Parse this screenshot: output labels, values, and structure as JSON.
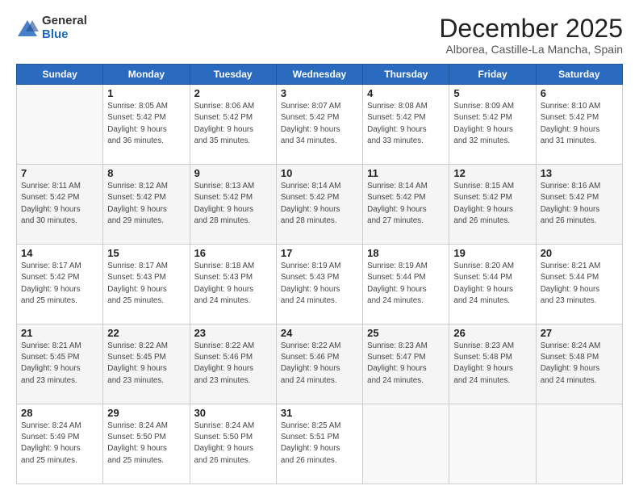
{
  "header": {
    "logo_line1": "General",
    "logo_line2": "Blue",
    "title": "December 2025",
    "subtitle": "Alborea, Castille-La Mancha, Spain"
  },
  "calendar": {
    "days_of_week": [
      "Sunday",
      "Monday",
      "Tuesday",
      "Wednesday",
      "Thursday",
      "Friday",
      "Saturday"
    ],
    "weeks": [
      {
        "shade": false,
        "days": [
          {
            "num": "",
            "detail": ""
          },
          {
            "num": "1",
            "detail": "Sunrise: 8:05 AM\nSunset: 5:42 PM\nDaylight: 9 hours\nand 36 minutes."
          },
          {
            "num": "2",
            "detail": "Sunrise: 8:06 AM\nSunset: 5:42 PM\nDaylight: 9 hours\nand 35 minutes."
          },
          {
            "num": "3",
            "detail": "Sunrise: 8:07 AM\nSunset: 5:42 PM\nDaylight: 9 hours\nand 34 minutes."
          },
          {
            "num": "4",
            "detail": "Sunrise: 8:08 AM\nSunset: 5:42 PM\nDaylight: 9 hours\nand 33 minutes."
          },
          {
            "num": "5",
            "detail": "Sunrise: 8:09 AM\nSunset: 5:42 PM\nDaylight: 9 hours\nand 32 minutes."
          },
          {
            "num": "6",
            "detail": "Sunrise: 8:10 AM\nSunset: 5:42 PM\nDaylight: 9 hours\nand 31 minutes."
          }
        ]
      },
      {
        "shade": true,
        "days": [
          {
            "num": "7",
            "detail": "Sunrise: 8:11 AM\nSunset: 5:42 PM\nDaylight: 9 hours\nand 30 minutes."
          },
          {
            "num": "8",
            "detail": "Sunrise: 8:12 AM\nSunset: 5:42 PM\nDaylight: 9 hours\nand 29 minutes."
          },
          {
            "num": "9",
            "detail": "Sunrise: 8:13 AM\nSunset: 5:42 PM\nDaylight: 9 hours\nand 28 minutes."
          },
          {
            "num": "10",
            "detail": "Sunrise: 8:14 AM\nSunset: 5:42 PM\nDaylight: 9 hours\nand 28 minutes."
          },
          {
            "num": "11",
            "detail": "Sunrise: 8:14 AM\nSunset: 5:42 PM\nDaylight: 9 hours\nand 27 minutes."
          },
          {
            "num": "12",
            "detail": "Sunrise: 8:15 AM\nSunset: 5:42 PM\nDaylight: 9 hours\nand 26 minutes."
          },
          {
            "num": "13",
            "detail": "Sunrise: 8:16 AM\nSunset: 5:42 PM\nDaylight: 9 hours\nand 26 minutes."
          }
        ]
      },
      {
        "shade": false,
        "days": [
          {
            "num": "14",
            "detail": "Sunrise: 8:17 AM\nSunset: 5:42 PM\nDaylight: 9 hours\nand 25 minutes."
          },
          {
            "num": "15",
            "detail": "Sunrise: 8:17 AM\nSunset: 5:43 PM\nDaylight: 9 hours\nand 25 minutes."
          },
          {
            "num": "16",
            "detail": "Sunrise: 8:18 AM\nSunset: 5:43 PM\nDaylight: 9 hours\nand 24 minutes."
          },
          {
            "num": "17",
            "detail": "Sunrise: 8:19 AM\nSunset: 5:43 PM\nDaylight: 9 hours\nand 24 minutes."
          },
          {
            "num": "18",
            "detail": "Sunrise: 8:19 AM\nSunset: 5:44 PM\nDaylight: 9 hours\nand 24 minutes."
          },
          {
            "num": "19",
            "detail": "Sunrise: 8:20 AM\nSunset: 5:44 PM\nDaylight: 9 hours\nand 24 minutes."
          },
          {
            "num": "20",
            "detail": "Sunrise: 8:21 AM\nSunset: 5:44 PM\nDaylight: 9 hours\nand 23 minutes."
          }
        ]
      },
      {
        "shade": true,
        "days": [
          {
            "num": "21",
            "detail": "Sunrise: 8:21 AM\nSunset: 5:45 PM\nDaylight: 9 hours\nand 23 minutes."
          },
          {
            "num": "22",
            "detail": "Sunrise: 8:22 AM\nSunset: 5:45 PM\nDaylight: 9 hours\nand 23 minutes."
          },
          {
            "num": "23",
            "detail": "Sunrise: 8:22 AM\nSunset: 5:46 PM\nDaylight: 9 hours\nand 23 minutes."
          },
          {
            "num": "24",
            "detail": "Sunrise: 8:22 AM\nSunset: 5:46 PM\nDaylight: 9 hours\nand 24 minutes."
          },
          {
            "num": "25",
            "detail": "Sunrise: 8:23 AM\nSunset: 5:47 PM\nDaylight: 9 hours\nand 24 minutes."
          },
          {
            "num": "26",
            "detail": "Sunrise: 8:23 AM\nSunset: 5:48 PM\nDaylight: 9 hours\nand 24 minutes."
          },
          {
            "num": "27",
            "detail": "Sunrise: 8:24 AM\nSunset: 5:48 PM\nDaylight: 9 hours\nand 24 minutes."
          }
        ]
      },
      {
        "shade": false,
        "days": [
          {
            "num": "28",
            "detail": "Sunrise: 8:24 AM\nSunset: 5:49 PM\nDaylight: 9 hours\nand 25 minutes."
          },
          {
            "num": "29",
            "detail": "Sunrise: 8:24 AM\nSunset: 5:50 PM\nDaylight: 9 hours\nand 25 minutes."
          },
          {
            "num": "30",
            "detail": "Sunrise: 8:24 AM\nSunset: 5:50 PM\nDaylight: 9 hours\nand 26 minutes."
          },
          {
            "num": "31",
            "detail": "Sunrise: 8:25 AM\nSunset: 5:51 PM\nDaylight: 9 hours\nand 26 minutes."
          },
          {
            "num": "",
            "detail": ""
          },
          {
            "num": "",
            "detail": ""
          },
          {
            "num": "",
            "detail": ""
          }
        ]
      }
    ]
  }
}
